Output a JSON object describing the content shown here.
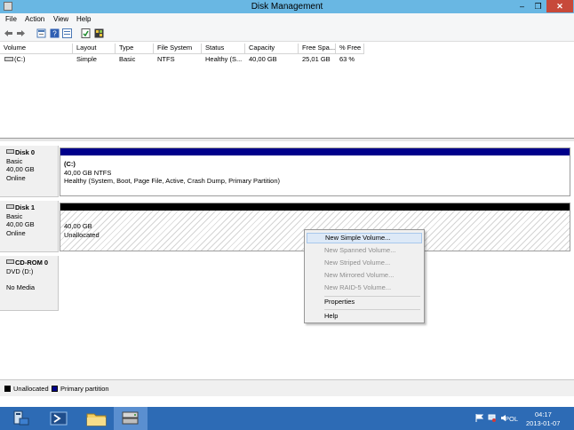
{
  "window": {
    "title": "Disk Management",
    "close_glyph": "✕",
    "max_glyph": "❐",
    "min_glyph": "–"
  },
  "menubar": {
    "items": [
      "File",
      "Action",
      "View",
      "Help"
    ]
  },
  "toolbar": {
    "icons": [
      "back-arrow-icon",
      "forward-arrow-icon",
      "properties-icon",
      "help-icon",
      "list-view-icon",
      "check-icon",
      "grid-icon"
    ]
  },
  "volume_list": {
    "columns": [
      "Volume",
      "Layout",
      "Type",
      "File System",
      "Status",
      "Capacity",
      "Free Spa...",
      "% Free"
    ],
    "rows": [
      {
        "volume": "(C:)",
        "layout": "Simple",
        "type": "Basic",
        "file_system": "NTFS",
        "status": "Healthy (S...",
        "capacity": "40,00 GB",
        "free_space": "25,01 GB",
        "percent_free": "63 %"
      }
    ]
  },
  "disks": [
    {
      "name": "Disk 0",
      "type": "Basic",
      "size": "40,00 GB",
      "state": "Online",
      "partition": {
        "label": "(C:)",
        "size_fs": "40,00 GB NTFS",
        "status": "Healthy (System, Boot, Page File, Active, Crash Dump, Primary Partition)"
      }
    },
    {
      "name": "Disk 1",
      "type": "Basic",
      "size": "40,00 GB",
      "state": "Online",
      "partition": {
        "size": "40,00 GB",
        "status": "Unallocated"
      }
    },
    {
      "name": "CD-ROM 0",
      "type": "DVD (D:)",
      "state": "No Media"
    }
  ],
  "context_menu": {
    "items": [
      {
        "label": "New Simple Volume...",
        "enabled": true,
        "highlighted": true
      },
      {
        "label": "New Spanned Volume...",
        "enabled": false
      },
      {
        "label": "New Striped Volume...",
        "enabled": false
      },
      {
        "label": "New Mirrored Volume...",
        "enabled": false
      },
      {
        "label": "New RAID-5 Volume...",
        "enabled": false
      },
      {
        "label": "Properties",
        "enabled": true
      },
      {
        "label": "Help",
        "enabled": true
      }
    ]
  },
  "legend": {
    "items": [
      {
        "label": "Unallocated",
        "color": "#000000"
      },
      {
        "label": "Primary partition",
        "color": "#00008b"
      }
    ]
  },
  "taskbar": {
    "apps": [
      "server-manager-icon",
      "powershell-icon",
      "file-explorer-icon",
      "disk-management-icon"
    ],
    "language": "POL",
    "time": "04:17",
    "date": "2013-01-07"
  },
  "colors": {
    "titlebar": "#69b7e3",
    "taskbar": "#2d6bb5",
    "primary_partition": "#00008b",
    "unallocated": "#000000"
  }
}
